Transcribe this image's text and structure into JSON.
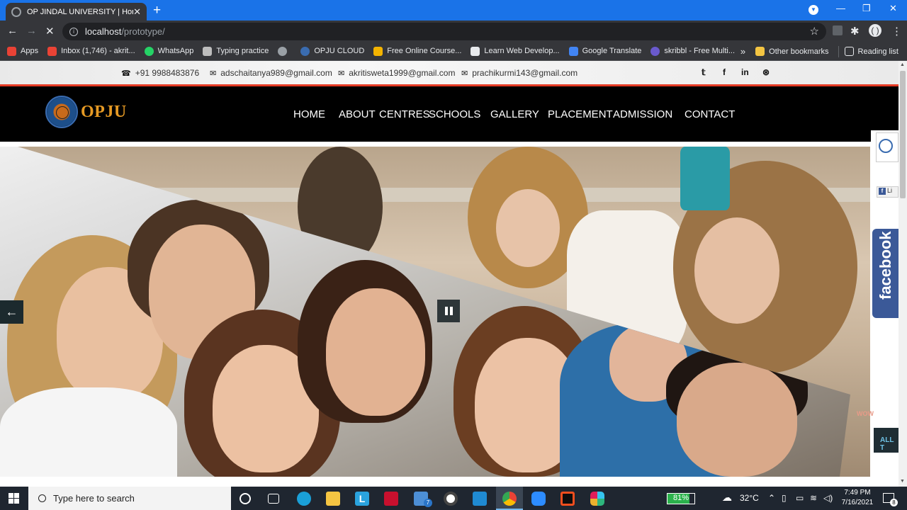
{
  "browser": {
    "tab_title": "OP JINDAL UNIVERSITY | Home",
    "tab_close": "✕",
    "new_tab": "+",
    "url_host": "localhost",
    "url_path": "/prototype/",
    "bookmarks": [
      {
        "label": "Apps",
        "color": "#e94235"
      },
      {
        "label": "Inbox (1,746) - akrit...",
        "color": "#ea4335"
      },
      {
        "label": "WhatsApp",
        "color": "#25d366"
      },
      {
        "label": "Typing practice",
        "color": "#bdbdbd"
      },
      {
        "label": "",
        "color": "#9aa0a6"
      },
      {
        "label": "OPJU CLOUD",
        "color": "#3a6cb0"
      },
      {
        "label": "Free Online Course...",
        "color": "#f4b400"
      },
      {
        "label": "Learn Web Develop...",
        "color": "#e8eaed"
      },
      {
        "label": "Google Translate",
        "color": "#4285f4"
      },
      {
        "label": "skribbl - Free Multi...",
        "color": "#6a5acd"
      }
    ],
    "overflow": "»",
    "other_bookmarks": "Other bookmarks",
    "reading_list": "Reading list"
  },
  "site": {
    "phone": "+91 9988483876",
    "emails": [
      "adschaitanya989@gmail.com",
      "akritisweta1999@gmail.com",
      "prachikurmi143@gmail.com"
    ],
    "social": [
      "twitter-icon",
      "facebook-icon",
      "linkedin-icon",
      "dribbble-icon"
    ],
    "social_glyphs": [
      "𝕥",
      "f",
      "in",
      "⊛"
    ],
    "logo_text": "OPJU",
    "nav": [
      "HOME",
      "ABOUT",
      "CENTRES",
      "SCHOOLS",
      "GALLERY",
      "PLACEMENT",
      "ADMISSION",
      "CONTACT"
    ],
    "side_like": "Li",
    "facebook_tab": "facebook",
    "all_tab": "ALL T",
    "wow_text": "WOW",
    "accent": "#e53b25",
    "logo_color": "#e69a24"
  },
  "taskbar": {
    "search_placeholder": "Type here to search",
    "mail_badge": "7",
    "battery": "81%",
    "battery_level": 0.81,
    "temperature": "32°C",
    "time": "7:49 PM",
    "date": "7/16/2021",
    "notifications": "8"
  }
}
